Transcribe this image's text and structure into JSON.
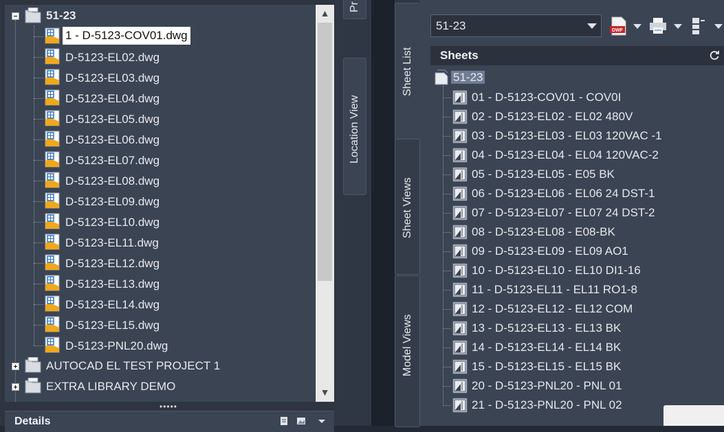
{
  "project_tree": {
    "root": {
      "label": "51-23",
      "expanded": true
    },
    "selected_file": "1 - D-5123-COV01.dwg",
    "files": [
      "D-5123-EL02.dwg",
      "D-5123-EL03.dwg",
      "D-5123-EL04.dwg",
      "D-5123-EL05.dwg",
      "D-5123-EL06.dwg",
      "D-5123-EL07.dwg",
      "D-5123-EL08.dwg",
      "D-5123-EL09.dwg",
      "D-5123-EL10.dwg",
      "D-5123-EL11.dwg",
      "D-5123-EL12.dwg",
      "D-5123-EL13.dwg",
      "D-5123-EL14.dwg",
      "D-5123-EL15.dwg",
      "D-5123-PNL20.dwg"
    ],
    "other_projects": [
      "AUTOCAD EL TEST PROJECT 1",
      "EXTRA LIBRARY DEMO"
    ],
    "scroll": {
      "up_arrow": "▲",
      "down_arrow": "▼"
    }
  },
  "splitter": {
    "grip": "•••••"
  },
  "details": {
    "title": "Details",
    "icons": [
      "preview-icon",
      "image-icon",
      "dropdown-icon"
    ]
  },
  "side_tabs": {
    "partial_top": "Pr",
    "location_view": "Location View"
  },
  "ssm": {
    "tabs": {
      "sheet_list": "Sheet List",
      "sheet_views": "Sheet Views",
      "model_views": "Model Views"
    },
    "active_tab": "Sheet List",
    "sheet_set_selector": "51-23",
    "toolbar": {
      "publish_label": "DWF",
      "icons": [
        "publish-dwf-icon",
        "plot-icon",
        "sheet-selections-icon"
      ]
    },
    "sheets_panel": {
      "title": "Sheets",
      "root": "51-23",
      "sheets": [
        "01 - D-5123-COV01 - COV0I",
        "02 - D-5123-EL02 - EL02  480V",
        "03 - D-5123-EL03 - EL03 120VAC -1",
        "04 - D-5123-EL04 - EL04 120VAC-2",
        "05 - D-5123-EL05 - E05 BK",
        "06 - D-5123-EL06 - EL06 24 DST-1",
        "07 - D-5123-EL07 - EL07 24 DST-2",
        "08 - D-5123-EL08 - E08-BK",
        "09 - D-5123-EL09 - EL09 AO1",
        "10 - D-5123-EL10 - EL10 DI1-16",
        "11 - D-5123-EL11 - EL11 RO1-8",
        "12 - D-5123-EL12 - EL12 COM",
        "13 - D-5123-EL13 - EL13 BK",
        "14 - D-5123-EL14 - EL14 BK",
        "15 - D-5123-EL15 - EL15 BK",
        "20 - D-5123-PNL20 - PNL 01",
        "21 - D-5123-PNL20 - PNL 02"
      ]
    }
  },
  "colors": {
    "panel": "#3b4453",
    "header": "#2b323d",
    "selection": "#6f7c93",
    "dwg_accent": "#f0a81c",
    "dwg_blue": "#2f74c6"
  }
}
